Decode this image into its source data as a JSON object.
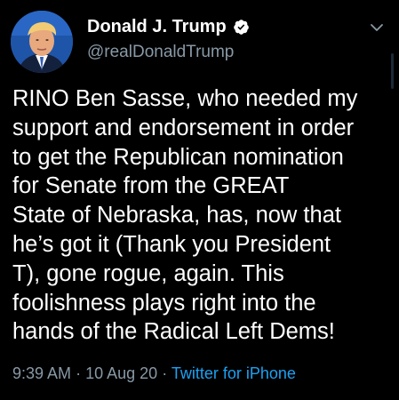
{
  "tweet": {
    "author": {
      "display_name": "Donald J. Trump",
      "handle": "@realDonaldTrump",
      "verified_icon": "verified-badge-icon"
    },
    "menu_icon": "chevron-down-icon",
    "lines": [
      "RINO Ben Sasse, who needed my",
      "support and endorsement in order",
      "to get the Republican nomination",
      "for Senate from the GREAT",
      "State of Nebraska, has, now that",
      "he’s got it (Thank you President",
      "T), gone rogue, again. This",
      "foolishness plays right into the",
      "hands of the Radical Left Dems!"
    ],
    "meta": {
      "time": "9:39 AM",
      "separator": "·",
      "date": "10 Aug 20",
      "source": "Twitter for iPhone"
    }
  },
  "colors": {
    "background": "#000000",
    "text": "#ffffff",
    "secondary": "#8899a6",
    "link": "#1da1f2"
  }
}
